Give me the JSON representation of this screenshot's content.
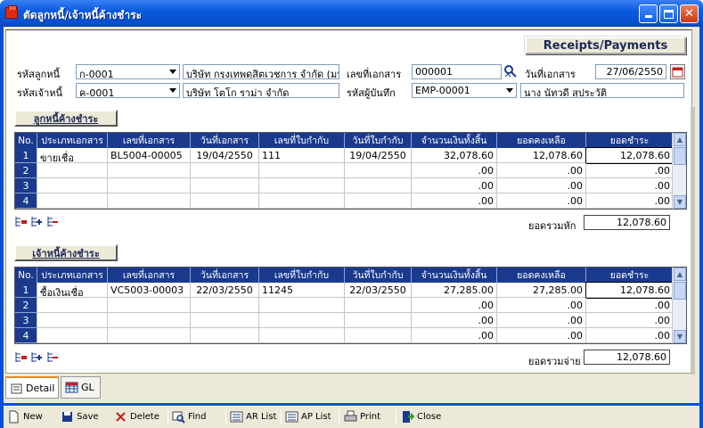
{
  "window": {
    "title": "ตัดลูกหนี้/เจ้าหนี้ค้างชำระ",
    "minimize": "_",
    "maximize": "□",
    "close": "✕"
  },
  "header": {
    "mode_button": "Receipts/Payments",
    "debtor_code_label": "รหัสลูกหนี้",
    "debtor_code": "ก-0001",
    "debtor_name": "บริษัท กรุงเทพดุสิตเวชการ จำกัด (มห",
    "creditor_code_label": "รหัสเจ้าหนี้",
    "creditor_code": "ค-0001",
    "creditor_name": "บริษัท โตโก ราม่า จำกัด",
    "doc_no_label": "เลขที่เอกสาร",
    "doc_no": "000001",
    "recorder_label": "รหัสผู้บันทึก",
    "recorder_code": "EMP-00001",
    "recorder_name": "นาง นัทวดี สุประวัติ",
    "doc_date_label": "วันที่เอกสาร",
    "doc_date": "27/06/2550"
  },
  "columns": [
    "No.",
    "ประเภทเอกสาร",
    "เลขที่เอกสาร",
    "วันที่เอกสาร",
    "เลขที่ใบกำกับ",
    "วันที่ใบกำกับ",
    "จำนวนเงินทั้งสิ้น",
    "ยอดคงเหลือ",
    "ยอดชำระ"
  ],
  "receivables": {
    "title": "ลูกหนี้ค้างชำระ",
    "total_label": "ยอดรวมหัก",
    "total": "12,078.60",
    "rows": [
      {
        "no": "1",
        "type": "ขายเชื่อ",
        "doc": "BL5004-00005",
        "date": "19/04/2550",
        "inv": "111",
        "inv_date": "19/04/2550",
        "amount": "32,078.60",
        "balance": "12,078.60",
        "pay": "12,078.60"
      },
      {
        "no": "2",
        "type": "",
        "doc": "",
        "date": "",
        "inv": "",
        "inv_date": "",
        "amount": ".00",
        "balance": ".00",
        "pay": ".00"
      },
      {
        "no": "3",
        "type": "",
        "doc": "",
        "date": "",
        "inv": "",
        "inv_date": "",
        "amount": ".00",
        "balance": ".00",
        "pay": ".00"
      },
      {
        "no": "4",
        "type": "",
        "doc": "",
        "date": "",
        "inv": "",
        "inv_date": "",
        "amount": ".00",
        "balance": ".00",
        "pay": ".00"
      }
    ]
  },
  "payables": {
    "title": "เจ้าหนี้ค้างชำระ",
    "total_label": "ยอดรวมจ่าย",
    "total": "12,078.60",
    "rows": [
      {
        "no": "1",
        "type": "ซื้อเงินเชื่อ",
        "doc": "VC5003-00003",
        "date": "22/03/2550",
        "inv": "11245",
        "inv_date": "22/03/2550",
        "amount": "27,285.00",
        "balance": "27,285.00",
        "pay": "12,078.60"
      },
      {
        "no": "2",
        "type": "",
        "doc": "",
        "date": "",
        "inv": "",
        "inv_date": "",
        "amount": ".00",
        "balance": ".00",
        "pay": ".00"
      },
      {
        "no": "3",
        "type": "",
        "doc": "",
        "date": "",
        "inv": "",
        "inv_date": "",
        "amount": ".00",
        "balance": ".00",
        "pay": ".00"
      },
      {
        "no": "4",
        "type": "",
        "doc": "",
        "date": "",
        "inv": "",
        "inv_date": "",
        "amount": ".00",
        "balance": ".00",
        "pay": ".00"
      }
    ]
  },
  "tabs": {
    "detail": "Detail",
    "gl": "GL"
  },
  "toolbar": {
    "new": "New",
    "save": "Save",
    "delete": "Delete",
    "find": "Find",
    "ar_list": "AR List",
    "ap_list": "AP List",
    "print": "Print",
    "close": "Close"
  },
  "icons": {
    "app": "folder-icon",
    "search": "search-person-icon",
    "calendar": "calendar-icon"
  },
  "colors": {
    "title_bar": "#0a5ae0",
    "grid_header": "#1a3a8e",
    "section_label": "#1c2a55"
  }
}
